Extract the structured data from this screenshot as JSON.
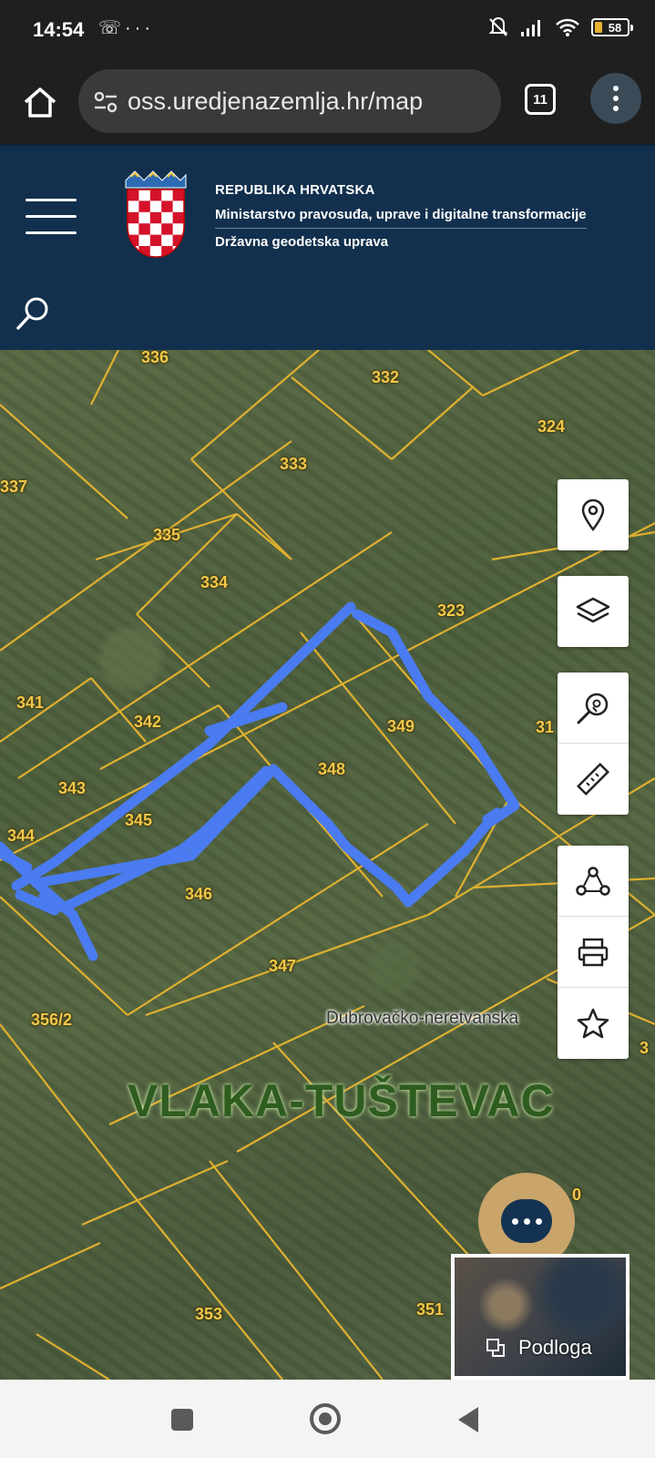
{
  "status_bar": {
    "time": "14:54",
    "left_icons": [
      "missed-call-icon",
      "more-dots-icon"
    ],
    "right_icons": [
      "mute-icon",
      "signal-icon",
      "wifi-icon",
      "battery-icon"
    ],
    "battery_level": "58"
  },
  "browser": {
    "url": "oss.uredjenazemlja.hr/map",
    "tab_count": "11"
  },
  "header": {
    "line1": "REPUBLIKA HRVATSKA",
    "line2": "Ministarstvo pravosuđa, uprave i digitalne transformacije",
    "line3": "Državna geodetska uprava"
  },
  "map": {
    "parcels": [
      {
        "id": "p336",
        "label": "336"
      },
      {
        "id": "p332",
        "label": "332"
      },
      {
        "id": "p324",
        "label": "324"
      },
      {
        "id": "p337",
        "label": "337"
      },
      {
        "id": "p333",
        "label": "333"
      },
      {
        "id": "p335",
        "label": "335"
      },
      {
        "id": "p334",
        "label": "334"
      },
      {
        "id": "p323",
        "label": "323"
      },
      {
        "id": "p341",
        "label": "341"
      },
      {
        "id": "p342",
        "label": "342"
      },
      {
        "id": "p349",
        "label": "349"
      },
      {
        "id": "p31x",
        "label": "31"
      },
      {
        "id": "p348",
        "label": "348"
      },
      {
        "id": "p343",
        "label": "343"
      },
      {
        "id": "p345",
        "label": "345"
      },
      {
        "id": "p344",
        "label": "344"
      },
      {
        "id": "p346",
        "label": "346"
      },
      {
        "id": "p347",
        "label": "347"
      },
      {
        "id": "p3562",
        "label": "356/2"
      },
      {
        "id": "p3x",
        "label": "3"
      },
      {
        "id": "p353",
        "label": "353"
      },
      {
        "id": "p351",
        "label": "351"
      },
      {
        "id": "p0x",
        "label": "0"
      }
    ],
    "region_label": "Dubrovačko-neretvanska",
    "place_label": "VLAKA-TUŠTEVAC",
    "basemap_label": "Podloga",
    "accent_line_color": "#4a7bf0",
    "parcel_line_color": "#e0b030"
  },
  "tools": [
    {
      "name": "location-pin-icon"
    },
    {
      "name": "layers-icon"
    },
    {
      "name": "search-location-icon"
    },
    {
      "name": "ruler-icon"
    },
    {
      "name": "share-nodes-icon"
    },
    {
      "name": "print-icon"
    },
    {
      "name": "star-icon"
    }
  ]
}
